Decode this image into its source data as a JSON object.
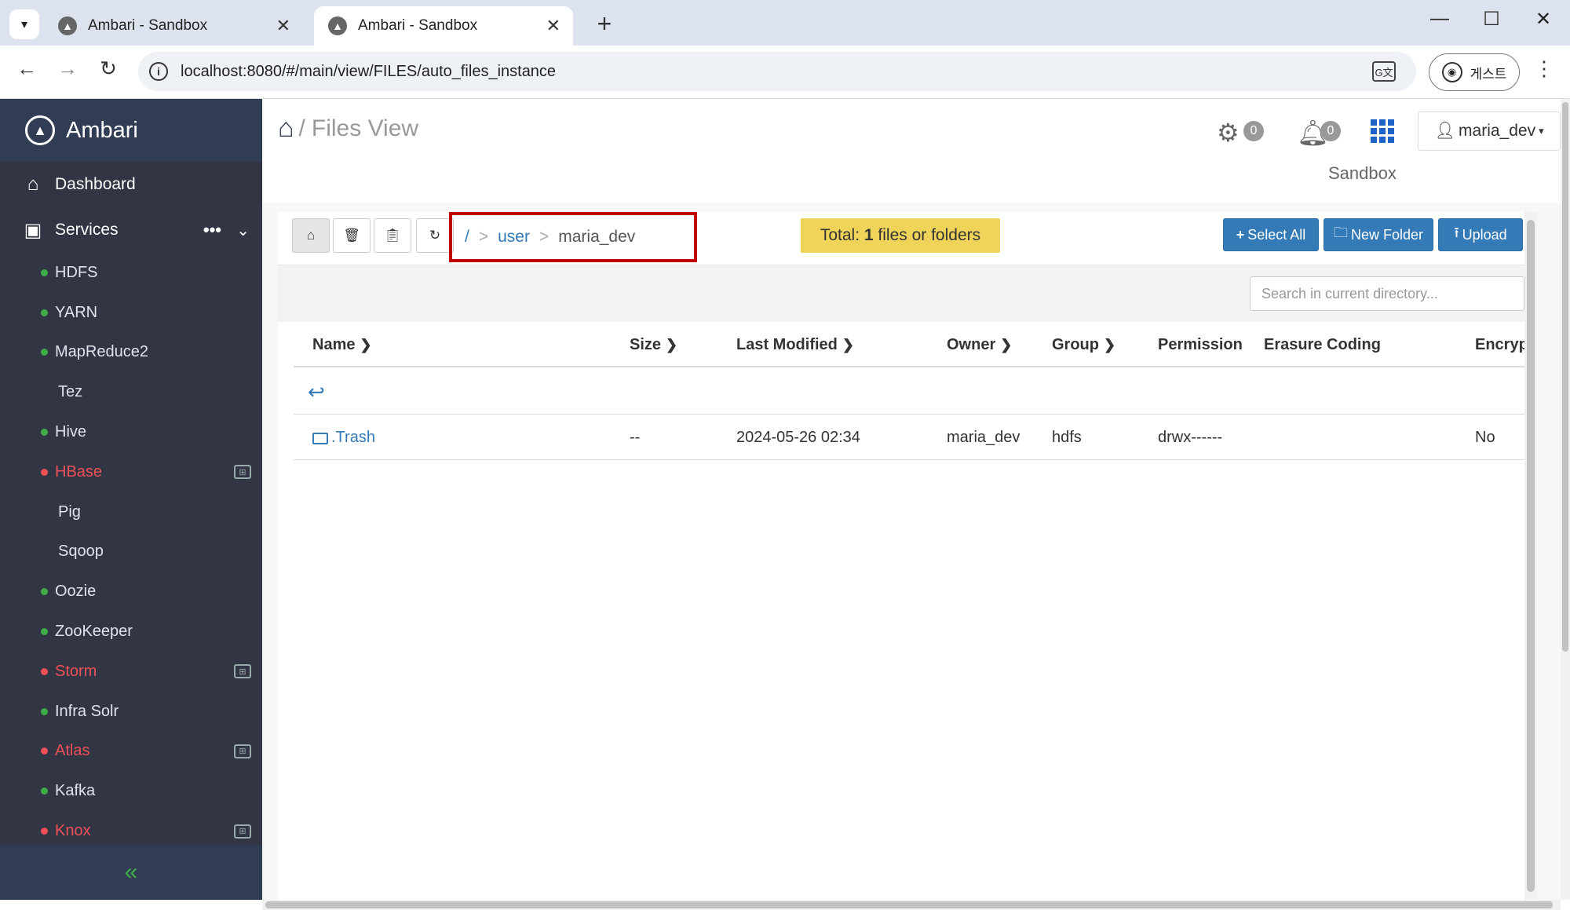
{
  "browser": {
    "tabs": [
      {
        "title": "Ambari - Sandbox",
        "active": false
      },
      {
        "title": "Ambari - Sandbox",
        "active": true
      }
    ],
    "url": "localhost:8080/#/main/view/FILES/auto_files_instance",
    "profile_label": "게스트"
  },
  "sidebar": {
    "brand": "Ambari",
    "dashboard_label": "Dashboard",
    "services_label": "Services",
    "services": [
      {
        "name": "HDFS",
        "status": "green"
      },
      {
        "name": "YARN",
        "status": "green"
      },
      {
        "name": "MapReduce2",
        "status": "green"
      },
      {
        "name": "Tez",
        "status": "none"
      },
      {
        "name": "Hive",
        "status": "green"
      },
      {
        "name": "HBase",
        "status": "red",
        "maintenance": true
      },
      {
        "name": "Pig",
        "status": "none"
      },
      {
        "name": "Sqoop",
        "status": "none"
      },
      {
        "name": "Oozie",
        "status": "green"
      },
      {
        "name": "ZooKeeper",
        "status": "green"
      },
      {
        "name": "Storm",
        "status": "red",
        "maintenance": true
      },
      {
        "name": "Infra Solr",
        "status": "green"
      },
      {
        "name": "Atlas",
        "status": "red",
        "maintenance": true
      },
      {
        "name": "Kafka",
        "status": "green"
      },
      {
        "name": "Knox",
        "status": "red",
        "maintenance": true
      }
    ],
    "collapse_label": "«"
  },
  "header": {
    "page_title": "Files View",
    "crumb_sep": "/",
    "ops_count": "0",
    "alerts_count": "0",
    "user": "maria_dev",
    "cluster_name": "Sandbox"
  },
  "files": {
    "path": {
      "root": "/",
      "segments": [
        "user",
        "maria_dev"
      ],
      "sep": ">"
    },
    "total_prefix": "Total: ",
    "total_count": "1",
    "total_suffix": " files or folders",
    "buttons": {
      "select_all": "Select All",
      "new_folder": "New Folder",
      "upload": "Upload"
    },
    "search_placeholder": "Search in current directory...",
    "columns": [
      "Name",
      "Size",
      "Last Modified",
      "Owner",
      "Group",
      "Permission",
      "Erasure Coding",
      "Encryp"
    ],
    "rows": [
      {
        "name": ".Trash",
        "size": "--",
        "modified": "2024-05-26 02:34",
        "owner": "maria_dev",
        "group": "hdfs",
        "permission": "drwx------",
        "erasure": "",
        "encrypted": "No"
      }
    ]
  },
  "colors": {
    "sidebar_bg": "#323544",
    "brand_bg": "#313d54",
    "primary": "#337ab7",
    "total_bg": "#f0d45a",
    "status_green": "#3fae49",
    "status_red": "#ef4f56",
    "highlight_border": "#c00000"
  }
}
